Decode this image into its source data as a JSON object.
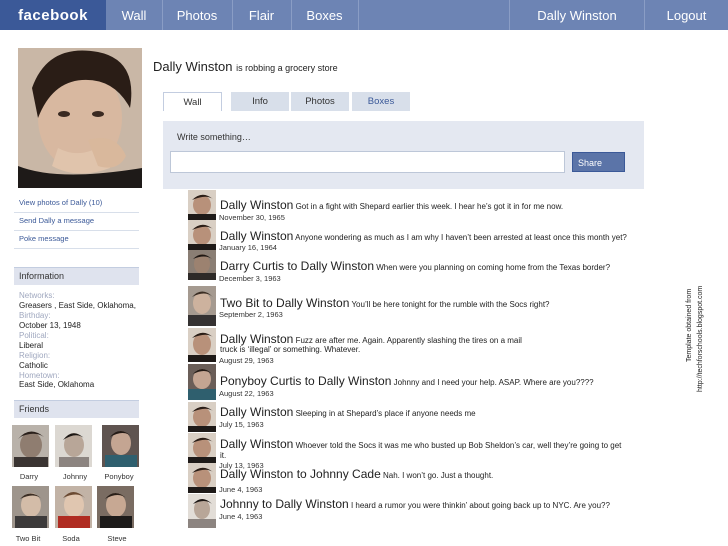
{
  "nav": {
    "logo": "facebook",
    "wall": "Wall",
    "photos": "Photos",
    "flair": "Flair",
    "boxes": "Boxes",
    "user": "Dally Winston",
    "logout": "Logout"
  },
  "sidebar": {
    "links": [
      "View photos of Dally (10)",
      "Send Dally a message",
      "Poke message"
    ],
    "information_heading": "Information",
    "info": {
      "networks_label": "Networks:",
      "networks_value": "Greasers , East Side, Oklahoma,",
      "birthday_label": "Birthday:",
      "birthday_value": "October 13, 1948",
      "political_label": "Political:",
      "political_value": "Liberal",
      "religion_label": "Religion:",
      "religion_value": "Catholic",
      "hometown_label": "Hometown:",
      "hometown_value": "East Side, Oklahoma"
    },
    "friends_heading": "Friends",
    "friends": [
      "Darry",
      "Johnny",
      "Ponyboy",
      "Two Bit",
      "Soda",
      "Steve"
    ]
  },
  "profile": {
    "name": "Dally Winston",
    "status": "is robbing a grocery store"
  },
  "tabs": [
    "Wall",
    "Info",
    "Photos",
    "Boxes"
  ],
  "wall": {
    "prompt": "Write something…",
    "share_label": "Share"
  },
  "posts": [
    {
      "author": "Dally Winston",
      "text": " Got in a fight with Shepard earlier this week. I hear he’s got it in for me now.",
      "cont": "",
      "date": "November  30, 1965"
    },
    {
      "author": "Dally Winston",
      "text": " Anyone wondering as much as I am why I haven’t been arrested at least once this month yet?",
      "cont": "",
      "date": "January 16, 1964"
    },
    {
      "author": "Darry Curtis to Dally Winston",
      "text": " When were you planning on coming home from the Texas border?",
      "cont": "",
      "date": "December 3, 1963"
    },
    {
      "author": "Two Bit to Dally Winston",
      "text": "  You’ll be here tonight for the rumble with the Socs right?",
      "cont": "",
      "date": "September 2, 1963"
    },
    {
      "author": "Dally Winston",
      "text": "  Fuzz are after me. Again.  Apparently slashing the tires on a mail",
      "cont": "truck is ‘illegal’ or something.  Whatever.",
      "date": "August 29, 1963"
    },
    {
      "author": "Ponyboy Curtis to Dally Winston",
      "text": " Johnny and I need your help. ASAP. Where are you????",
      "cont": "",
      "date": "August 22, 1963"
    },
    {
      "author": "Dally Winston",
      "text": " Sleeping in at Shepard’s place if anyone needs me",
      "cont": "",
      "date": "July 15, 1963"
    },
    {
      "author": "Dally Winston",
      "text": " Whoever told the Socs it was me who busted up Bob Sheldon’s car, well they’re going to get",
      "cont": "it.",
      "date": "July 13, 1963"
    },
    {
      "author": "Dally Winston to Johnny Cade",
      "text": " Nah. I won’t go. Just a thought.",
      "cont": "",
      "date": "June 4, 1963"
    },
    {
      "author": "Johnny to Dally Winston",
      "text": " I heard a rumor you were thinkin’ about going back up to NYC. Are you??",
      "cont": "",
      "date": "June 4, 1963"
    }
  ],
  "credit": {
    "line1": "Template obtained from",
    "line2": "http://techforschools.blogspot.com"
  }
}
